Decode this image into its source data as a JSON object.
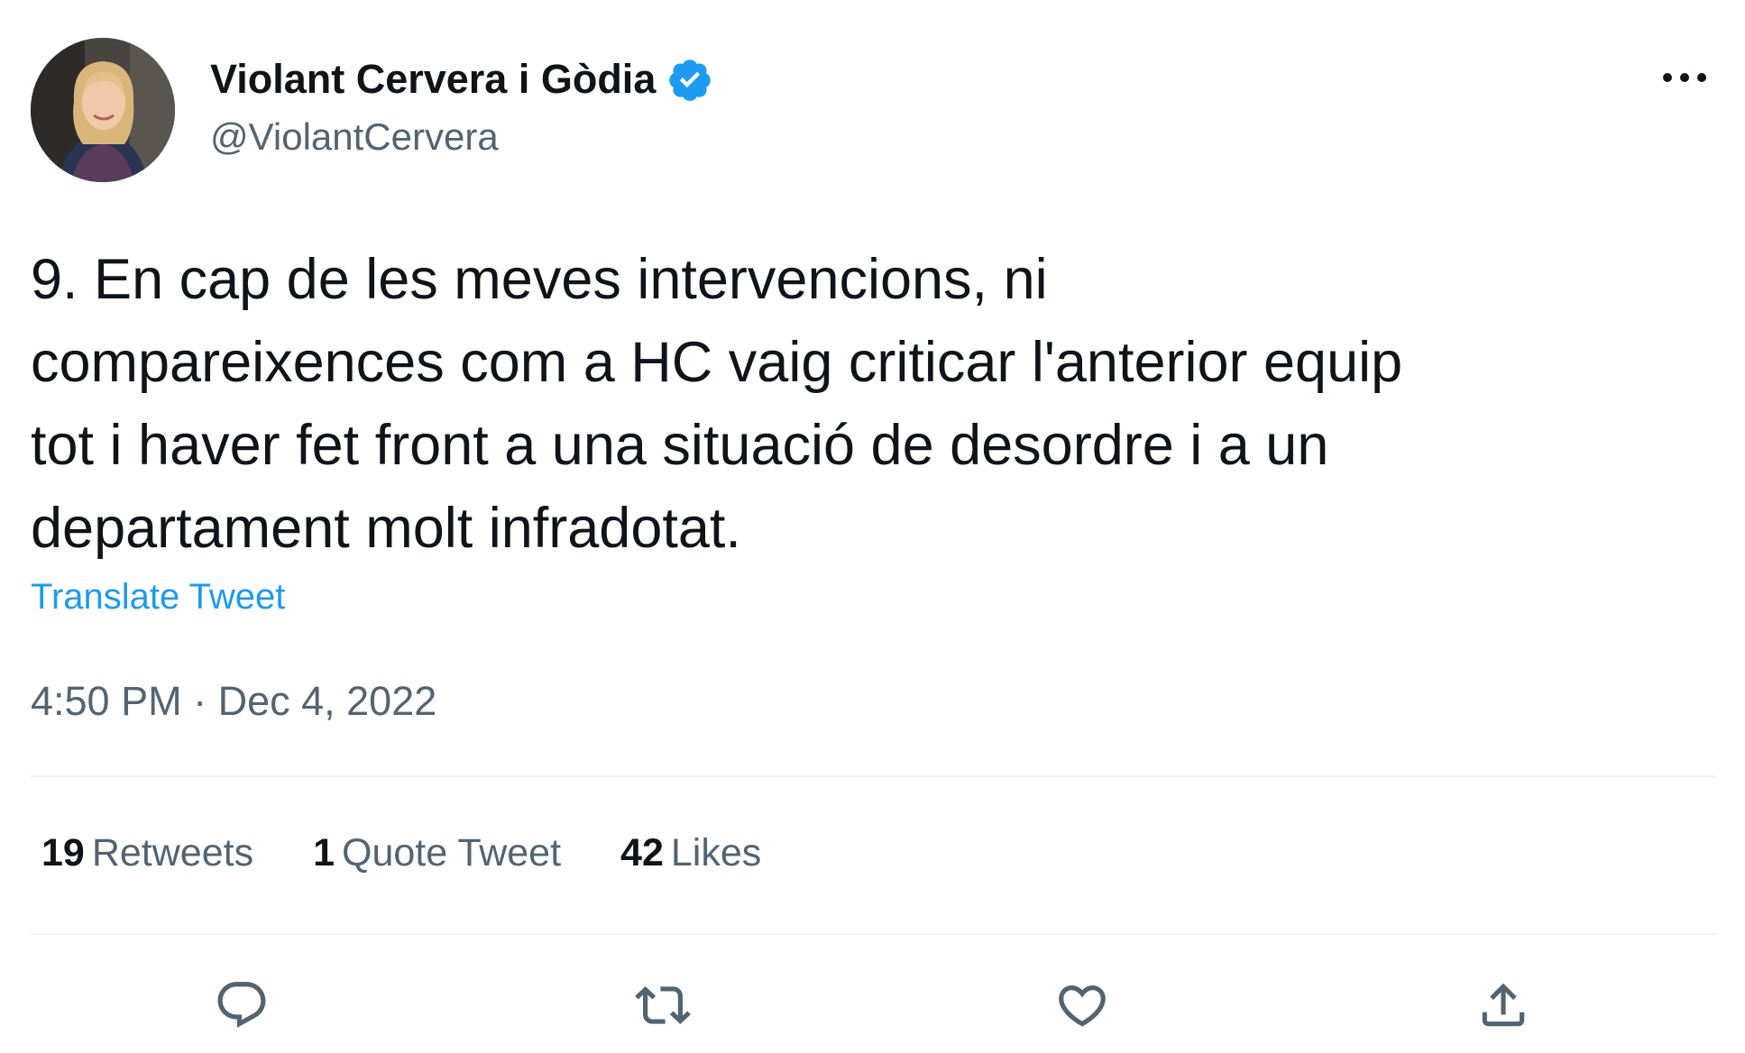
{
  "author": {
    "display_name": "Violant Cervera i Gòdia",
    "handle": "@ViolantCervera",
    "verified": true
  },
  "tweet": {
    "text": "9. En cap de les meves intervencions, ni\ncompareixences com a HC vaig criticar l'anterior equip\ntot i haver fet front a una situació de desordre i a un\ndepartament molt infradotat.",
    "translate_label": "Translate Tweet",
    "timestamp": "4:50 PM · Dec 4, 2022"
  },
  "stats": {
    "retweets_count": "19",
    "retweets_label": "Retweets",
    "quotes_count": "1",
    "quotes_label": "Quote Tweet",
    "likes_count": "42",
    "likes_label": "Likes"
  },
  "actions": [
    {
      "icon": "reply-icon"
    },
    {
      "icon": "retweet-icon"
    },
    {
      "icon": "like-icon"
    },
    {
      "icon": "share-icon"
    }
  ],
  "colors": {
    "accent": "#1d9bf0",
    "text": "#0f1419",
    "secondary": "#536471",
    "divider": "#eff3f4"
  }
}
